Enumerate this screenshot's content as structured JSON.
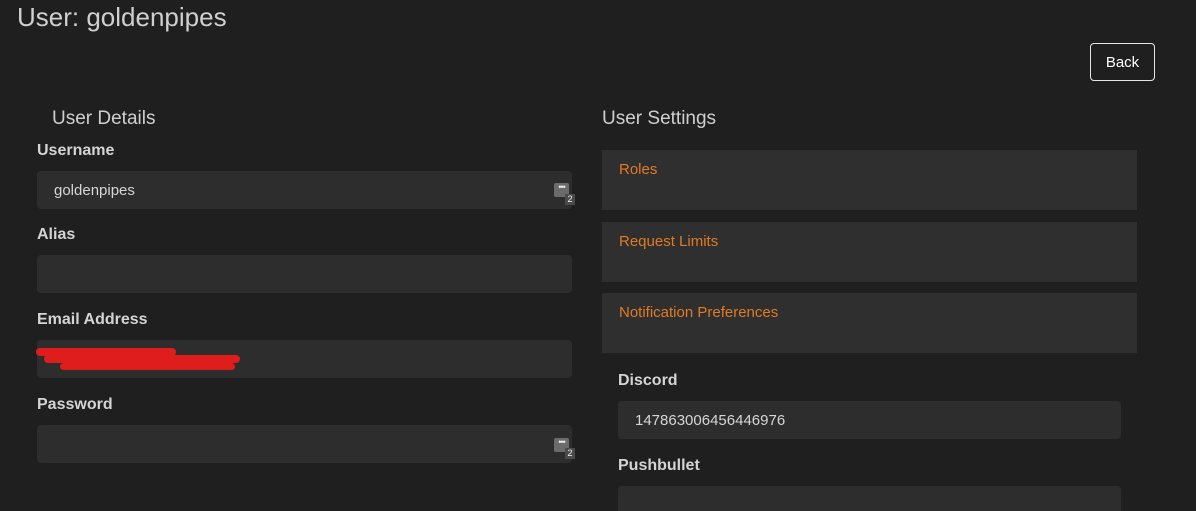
{
  "page": {
    "title": "User: goldenpipes"
  },
  "header": {
    "back_label": "Back"
  },
  "user_details": {
    "heading": "User Details",
    "username": {
      "label": "Username",
      "value": "goldenpipes",
      "badge": "2"
    },
    "alias": {
      "label": "Alias",
      "value": ""
    },
    "email": {
      "label": "Email Address",
      "value": ""
    },
    "password": {
      "label": "Password",
      "value": "",
      "badge": "2"
    }
  },
  "user_settings": {
    "heading": "User Settings",
    "sections": [
      {
        "label": "Roles"
      },
      {
        "label": "Request Limits"
      },
      {
        "label": "Notification Preferences"
      }
    ],
    "discord": {
      "label": "Discord",
      "value": "147863006456446976"
    },
    "pushbullet": {
      "label": "Pushbullet",
      "value": ""
    }
  },
  "colors": {
    "background": "#1f1f1f",
    "input": "#2d2d2d",
    "accent": "#e07b24"
  }
}
